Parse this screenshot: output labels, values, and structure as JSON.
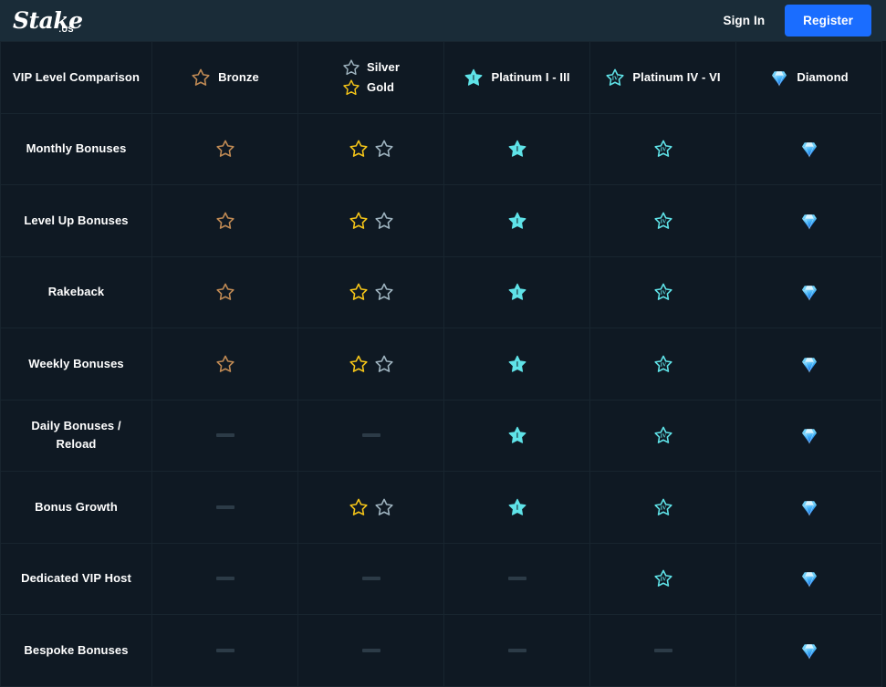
{
  "topbar": {
    "logo_word": "Stake",
    "logo_tld": ".US",
    "sign_in_label": "Sign In",
    "register_label": "Register",
    "register_color": "#1a6dff",
    "background_color": "#1a2c38"
  },
  "table": {
    "background_color": "#0f1923",
    "border_color": "#18252f",
    "corner_label": "VIP Level Comparison",
    "columns": [
      {
        "id": "bronze",
        "icons": [
          {
            "type": "star-outline",
            "color": "#c08a54",
            "numeral": ""
          }
        ],
        "labels": [
          "Bronze"
        ]
      },
      {
        "id": "silver-gold",
        "icons": [
          {
            "type": "star-outline",
            "color": "#9fb4c0",
            "numeral": ""
          },
          {
            "type": "star-outline",
            "color": "#f5c518",
            "numeral": ""
          }
        ],
        "labels": [
          "Silver",
          "Gold"
        ]
      },
      {
        "id": "platinum-1-3",
        "icons": [
          {
            "type": "star-filled",
            "color": "#5fe3e8",
            "numeral": "I"
          }
        ],
        "labels": [
          "Platinum I - III"
        ]
      },
      {
        "id": "platinum-4-6",
        "icons": [
          {
            "type": "star-outline-numeral",
            "color": "#5fe3e8",
            "numeral": "IV"
          }
        ],
        "labels": [
          "Platinum IV - VI"
        ]
      },
      {
        "id": "diamond",
        "icons": [
          {
            "type": "gem",
            "color": "#33a6f5",
            "numeral": ""
          }
        ],
        "labels": [
          "Diamond"
        ]
      }
    ],
    "rows": [
      {
        "label": "Monthly Bonuses",
        "cells": [
          {
            "icons": [
              {
                "type": "star-outline",
                "color": "#c08a54"
              }
            ]
          },
          {
            "icons": [
              {
                "type": "star-outline",
                "color": "#f5c518"
              },
              {
                "type": "star-outline",
                "color": "#9fb4c0"
              }
            ]
          },
          {
            "icons": [
              {
                "type": "star-filled",
                "color": "#5fe3e8",
                "numeral": "I"
              }
            ]
          },
          {
            "icons": [
              {
                "type": "star-outline-numeral",
                "color": "#5fe3e8",
                "numeral": "IV"
              }
            ]
          },
          {
            "icons": [
              {
                "type": "gem",
                "color": "#33a6f5"
              }
            ]
          }
        ]
      },
      {
        "label": "Level Up Bonuses",
        "cells": [
          {
            "icons": [
              {
                "type": "star-outline",
                "color": "#c08a54"
              }
            ]
          },
          {
            "icons": [
              {
                "type": "star-outline",
                "color": "#f5c518"
              },
              {
                "type": "star-outline",
                "color": "#9fb4c0"
              }
            ]
          },
          {
            "icons": [
              {
                "type": "star-filled",
                "color": "#5fe3e8",
                "numeral": "I"
              }
            ]
          },
          {
            "icons": [
              {
                "type": "star-outline-numeral",
                "color": "#5fe3e8",
                "numeral": "IV"
              }
            ]
          },
          {
            "icons": [
              {
                "type": "gem",
                "color": "#33a6f5"
              }
            ]
          }
        ]
      },
      {
        "label": "Rakeback",
        "cells": [
          {
            "icons": [
              {
                "type": "star-outline",
                "color": "#c08a54"
              }
            ]
          },
          {
            "icons": [
              {
                "type": "star-outline",
                "color": "#f5c518"
              },
              {
                "type": "star-outline",
                "color": "#9fb4c0"
              }
            ]
          },
          {
            "icons": [
              {
                "type": "star-filled",
                "color": "#5fe3e8",
                "numeral": "I"
              }
            ]
          },
          {
            "icons": [
              {
                "type": "star-outline-numeral",
                "color": "#5fe3e8",
                "numeral": "IV"
              }
            ]
          },
          {
            "icons": [
              {
                "type": "gem",
                "color": "#33a6f5"
              }
            ]
          }
        ]
      },
      {
        "label": "Weekly Bonuses",
        "cells": [
          {
            "icons": [
              {
                "type": "star-outline",
                "color": "#c08a54"
              }
            ]
          },
          {
            "icons": [
              {
                "type": "star-outline",
                "color": "#f5c518"
              },
              {
                "type": "star-outline",
                "color": "#9fb4c0"
              }
            ]
          },
          {
            "icons": [
              {
                "type": "star-filled",
                "color": "#5fe3e8",
                "numeral": "I"
              }
            ]
          },
          {
            "icons": [
              {
                "type": "star-outline-numeral",
                "color": "#5fe3e8",
                "numeral": "IV"
              }
            ]
          },
          {
            "icons": [
              {
                "type": "gem",
                "color": "#33a6f5"
              }
            ]
          }
        ]
      },
      {
        "label": "Daily Bonuses / Reload",
        "cells": [
          {
            "icons": [
              {
                "type": "dash"
              }
            ]
          },
          {
            "icons": [
              {
                "type": "dash"
              }
            ]
          },
          {
            "icons": [
              {
                "type": "star-filled",
                "color": "#5fe3e8",
                "numeral": "I"
              }
            ]
          },
          {
            "icons": [
              {
                "type": "star-outline-numeral",
                "color": "#5fe3e8",
                "numeral": "IV"
              }
            ]
          },
          {
            "icons": [
              {
                "type": "gem",
                "color": "#33a6f5"
              }
            ]
          }
        ]
      },
      {
        "label": "Bonus Growth",
        "cells": [
          {
            "icons": [
              {
                "type": "dash"
              }
            ]
          },
          {
            "icons": [
              {
                "type": "star-outline",
                "color": "#f5c518"
              },
              {
                "type": "star-outline",
                "color": "#9fb4c0"
              }
            ]
          },
          {
            "icons": [
              {
                "type": "star-filled",
                "color": "#5fe3e8",
                "numeral": "I"
              }
            ]
          },
          {
            "icons": [
              {
                "type": "star-outline-numeral",
                "color": "#5fe3e8",
                "numeral": "IV"
              }
            ]
          },
          {
            "icons": [
              {
                "type": "gem",
                "color": "#33a6f5"
              }
            ]
          }
        ]
      },
      {
        "label": "Dedicated VIP Host",
        "cells": [
          {
            "icons": [
              {
                "type": "dash"
              }
            ]
          },
          {
            "icons": [
              {
                "type": "dash"
              }
            ]
          },
          {
            "icons": [
              {
                "type": "dash"
              }
            ]
          },
          {
            "icons": [
              {
                "type": "star-outline-numeral",
                "color": "#5fe3e8",
                "numeral": "IV"
              }
            ]
          },
          {
            "icons": [
              {
                "type": "gem",
                "color": "#33a6f5"
              }
            ]
          }
        ]
      },
      {
        "label": "Bespoke Bonuses",
        "cells": [
          {
            "icons": [
              {
                "type": "dash"
              }
            ]
          },
          {
            "icons": [
              {
                "type": "dash"
              }
            ]
          },
          {
            "icons": [
              {
                "type": "dash"
              }
            ]
          },
          {
            "icons": [
              {
                "type": "dash"
              }
            ]
          },
          {
            "icons": [
              {
                "type": "gem",
                "color": "#33a6f5"
              }
            ]
          }
        ]
      }
    ]
  }
}
